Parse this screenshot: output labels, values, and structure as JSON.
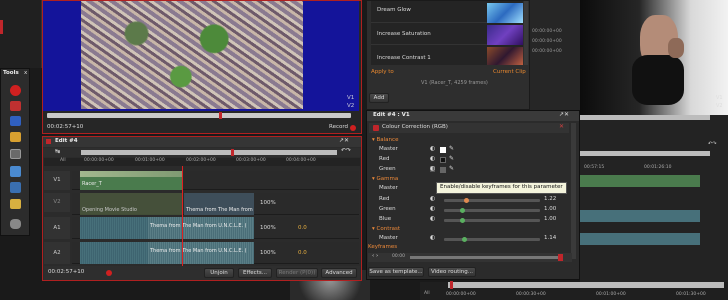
{
  "colors": {
    "accent_red": "#c0262b",
    "preview_blue": "#14149a",
    "orange": "#e8882f",
    "clip_green": "#4a7b4d",
    "clip_teal": "#47707a"
  },
  "tools": {
    "title": "Tools",
    "close": "x"
  },
  "left_monitor": {
    "timecode": "00:02:57+10",
    "record_label": "Record"
  },
  "edit_left": {
    "title": "Edit #4",
    "ruler": [
      "00:00:00+00",
      "00:01:00+00",
      "00:02:00+00",
      "00:03:00+00",
      "00:04:00+00"
    ],
    "tracks": [
      {
        "id": "V1",
        "clip": "Racer_T",
        "percent": ""
      },
      {
        "id": "V2",
        "clip": "Opening Movie Studio",
        "clip2": "Thema from The Man from",
        "percent": "100%"
      },
      {
        "id": "A1",
        "clip": "Thema from The Man from U.N.C.L.E.",
        "clip2": "Thema from The Man from U.N.C.L.E. (",
        "percent": "100%",
        "val": "0.0"
      },
      {
        "id": "A2",
        "clip": "Thema from The Man from U.N.C.L.E.",
        "clip2": "Thema from The Man from U.N.C.L.E. (",
        "percent": "100%",
        "val": "0.0"
      }
    ],
    "all_label": "All",
    "bottom_timecode": "00:02:57+10",
    "buttons": {
      "unjoin": "Unjoin",
      "effects": "Effects...",
      "render": "Render (P(0))",
      "advanced": "Advanced"
    }
  },
  "effects_list": {
    "items": [
      "Dream Glow",
      "Increase Saturation",
      "Increase Contrast 1"
    ],
    "apply_to": "Apply to",
    "current_clip": "Current Clip",
    "clip_info": "V1 (Racer_T, 4259 frames)",
    "add_button": "Add",
    "timecodes": [
      "00:00:00+00",
      "00:00:00+00",
      "00:00:00+00"
    ]
  },
  "edit_right": {
    "title": "Edit #4 : V1",
    "filter_name": "Colour Correction (RGB)",
    "sections": {
      "balance": "Balance",
      "gamma": "Gamma",
      "contrast": "Contrast",
      "keyframes": "Keyframes"
    },
    "balance_rows": [
      {
        "label": "Master"
      },
      {
        "label": "Red"
      },
      {
        "label": "Green"
      }
    ],
    "gamma_rows": [
      {
        "label": "Master",
        "value": ""
      },
      {
        "label": "Red",
        "value": "1.22",
        "level": 0.22
      },
      {
        "label": "Green",
        "value": "1.00",
        "level": 0.18
      },
      {
        "label": "Blue",
        "value": "1.00",
        "level": 0.18
      }
    ],
    "contrast_rows": [
      {
        "label": "Master",
        "value": "1.14",
        "level": 0.2
      }
    ],
    "tooltip": "Enable/disable keyframes for this parameter",
    "keyframe_time": "00:00",
    "save_template": "Save as template...",
    "video_routing": "Video routing..."
  },
  "right_timeline": {
    "ruler": [
      "00:57:15",
      "00:01:26:10"
    ],
    "bottom_ruler": [
      "00:00:00+00",
      "00:00:30+00",
      "00:01:00+00",
      "00:01:30+00"
    ],
    "all_label": "All",
    "track_labels": [
      "V1",
      "V2",
      "A1",
      "A2"
    ]
  }
}
